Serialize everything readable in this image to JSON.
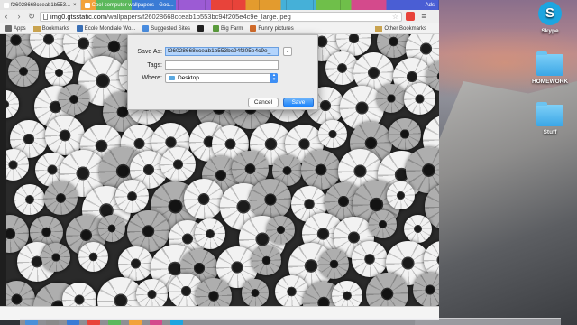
{
  "tabs": [
    {
      "label": "f26028668cceab1b553...",
      "active": true
    },
    {
      "label": "Cool computer wallpapers - Goo...",
      "active": false
    },
    {
      "label": "",
      "active": false
    },
    {
      "label": "",
      "active": false
    },
    {
      "label": "",
      "active": false
    },
    {
      "label": "",
      "active": false
    },
    {
      "label": "",
      "active": false
    },
    {
      "label": "",
      "active": false
    },
    {
      "label": "Ads",
      "active": false
    }
  ],
  "address_bar": {
    "host": "img0.gtsstatic.com",
    "path": "/wallpapers/f26028668cceab1b553bc94f205e4c9e_large.jpeg"
  },
  "bookmarks": [
    {
      "label": "Apps",
      "icon": "apps-grid-icon",
      "color": "#6a6a6a"
    },
    {
      "label": "Bookmarks",
      "icon": "folder-icon",
      "color": "#c9a34f"
    },
    {
      "label": "Ecole Mondiale Wo...",
      "icon": "school-icon",
      "color": "#3a6fb5"
    },
    {
      "label": "Suggested Sites",
      "icon": "sites-icon",
      "color": "#4a8de0"
    },
    {
      "label": "",
      "icon": "fa-badge-icon",
      "color": "#222222"
    },
    {
      "label": "Big Farm",
      "icon": "bigfarm-icon",
      "color": "#5b9c3d"
    },
    {
      "label": "Funny pictures",
      "icon": "funny-icon",
      "color": "#d06a2a"
    }
  ],
  "other_bookmarks": "Other Bookmarks",
  "save_dialog": {
    "save_as_label": "Save As:",
    "save_as_value": "f26028668cceab1b553bc94f205e4c9e_",
    "tags_label": "Tags:",
    "tags_value": "",
    "where_label": "Where:",
    "where_value": "Desktop",
    "cancel_label": "Cancel",
    "save_label": "Save"
  },
  "desktop_icons": [
    {
      "label": "Skype"
    },
    {
      "label": "HOMEWORK"
    },
    {
      "label": "Stuff"
    }
  ],
  "colors": {
    "primary_button": "#1a82fb",
    "selection": "#b3d4fc"
  }
}
